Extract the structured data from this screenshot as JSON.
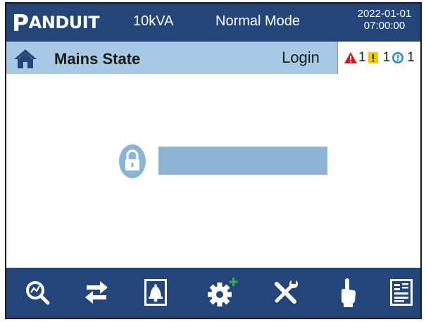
{
  "header": {
    "brand": "PANDUIT",
    "brand_first": "P",
    "brand_rest": "ANDUIT",
    "power_rating": "10kVA",
    "mode": "Normal Mode",
    "date": "2022-01-01",
    "time": "07:00:00"
  },
  "subheader": {
    "title": "Mains State",
    "login_label": "Login",
    "alarms": {
      "critical_count": "1",
      "warning_count": "1",
      "info_count": "1"
    }
  },
  "login_form": {
    "password_value": "",
    "password_placeholder": ""
  },
  "nav": {
    "items": [
      {
        "icon": "search-chart-icon"
      },
      {
        "icon": "swap-arrows-icon"
      },
      {
        "icon": "bell-icon"
      },
      {
        "icon": "settings-plus-icon"
      },
      {
        "icon": "tools-icon"
      },
      {
        "icon": "hand-pointer-icon"
      },
      {
        "icon": "log-document-icon"
      }
    ]
  },
  "colors": {
    "bar_dark": "#23457a",
    "bar_light": "#a8c9e3",
    "input_fill": "#8bb3d4",
    "alarm_red": "#d21a1a",
    "alarm_yellow": "#f5c400",
    "alarm_blue": "#2a7fe0"
  }
}
